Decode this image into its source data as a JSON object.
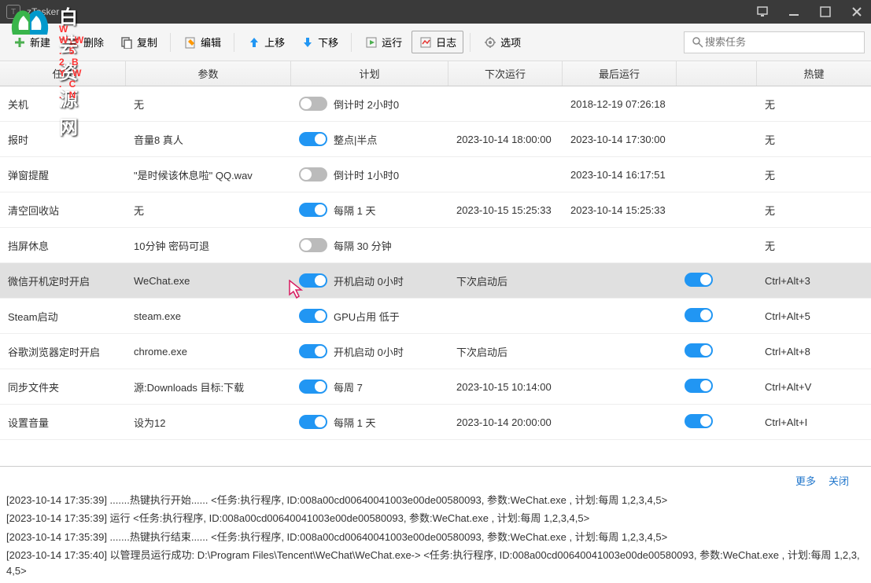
{
  "title": "zTasker",
  "watermark": {
    "brand": "白芸资源网",
    "url": "W W.W . 5 2 B Y W . C . N"
  },
  "toolbar": {
    "new": "新建",
    "delete": "删除",
    "copy": "复制",
    "edit": "编辑",
    "moveup": "上移",
    "movedown": "下移",
    "run": "运行",
    "log": "日志",
    "options": "选项",
    "search_placeholder": "搜索任务"
  },
  "columns": {
    "c1": "任务",
    "c2": "参数",
    "c3": "计划",
    "c4": "下次运行",
    "c5": "最后运行",
    "c6": "热键"
  },
  "rows": [
    {
      "task": "关机",
      "param": "无",
      "toggle": false,
      "plan": "倒计时 2小时0",
      "next": "",
      "last": "2018-12-19 07:26:18",
      "hk_toggle": false,
      "hotkey": "无"
    },
    {
      "task": "报时",
      "param": "音量8 真人",
      "toggle": true,
      "plan": "整点|半点",
      "next": "2023-10-14 18:00:00",
      "last": "2023-10-14 17:30:00",
      "hk_toggle": false,
      "hotkey": "无"
    },
    {
      "task": "弹窗提醒",
      "param": "\"是时候该休息啦\" QQ.wav",
      "toggle": false,
      "plan": "倒计时 1小时0",
      "next": "",
      "last": "2023-10-14 16:17:51",
      "hk_toggle": false,
      "hotkey": "无"
    },
    {
      "task": "清空回收站",
      "param": "无",
      "toggle": true,
      "plan": "每隔 1 天",
      "next": "2023-10-15 15:25:33",
      "last": "2023-10-14 15:25:33",
      "hk_toggle": false,
      "hotkey": "无"
    },
    {
      "task": "挡屏休息",
      "param": "10分钟 密码可退",
      "toggle": false,
      "plan": "每隔 30 分钟",
      "next": "",
      "last": "",
      "hk_toggle": false,
      "hotkey": "无"
    },
    {
      "task": "微信开机定时开启",
      "param": "WeChat.exe",
      "toggle": true,
      "plan": "开机启动 0小时",
      "next": "下次启动后",
      "last": "",
      "hk_toggle": true,
      "hotkey": "Ctrl+Alt+3",
      "selected": true
    },
    {
      "task": "Steam启动",
      "param": "steam.exe",
      "toggle": true,
      "plan": "GPU占用 低于",
      "next": "",
      "last": "",
      "hk_toggle": true,
      "hotkey": "Ctrl+Alt+5"
    },
    {
      "task": "谷歌浏览器定时开启",
      "param": "chrome.exe",
      "toggle": true,
      "plan": "开机启动 0小时",
      "next": "下次启动后",
      "last": "",
      "hk_toggle": true,
      "hotkey": "Ctrl+Alt+8"
    },
    {
      "task": "同步文件夹",
      "param": "源:Downloads 目标:下载",
      "toggle": true,
      "plan": "每周 7",
      "next": "2023-10-15 10:14:00",
      "last": "",
      "hk_toggle": true,
      "hotkey": "Ctrl+Alt+V"
    },
    {
      "task": "设置音量",
      "param": "设为12",
      "toggle": true,
      "plan": "每隔 1 天",
      "next": "2023-10-14 20:00:00",
      "last": "",
      "hk_toggle": true,
      "hotkey": "Ctrl+Alt+I"
    }
  ],
  "log": {
    "more": "更多",
    "close": "关闭",
    "lines": [
      "[2023-10-14 17:35:39] .......热键执行开始...... <任务:执行程序, ID:008a00cd00640041003e00de00580093, 参数:WeChat.exe , 计划:每周 1,2,3,4,5>",
      "[2023-10-14 17:35:39] 运行 <任务:执行程序, ID:008a00cd00640041003e00de00580093, 参数:WeChat.exe , 计划:每周 1,2,3,4,5>",
      "[2023-10-14 17:35:39] .......热键执行结束...... <任务:执行程序, ID:008a00cd00640041003e00de00580093, 参数:WeChat.exe , 计划:每周 1,2,3,4,5>",
      "[2023-10-14 17:35:40] 以管理员运行成功: D:\\Program Files\\Tencent\\WeChat\\WeChat.exe-> <任务:执行程序, ID:008a00cd00640041003e00de00580093, 参数:WeChat.exe , 计划:每周 1,2,3,4,5>"
    ]
  }
}
